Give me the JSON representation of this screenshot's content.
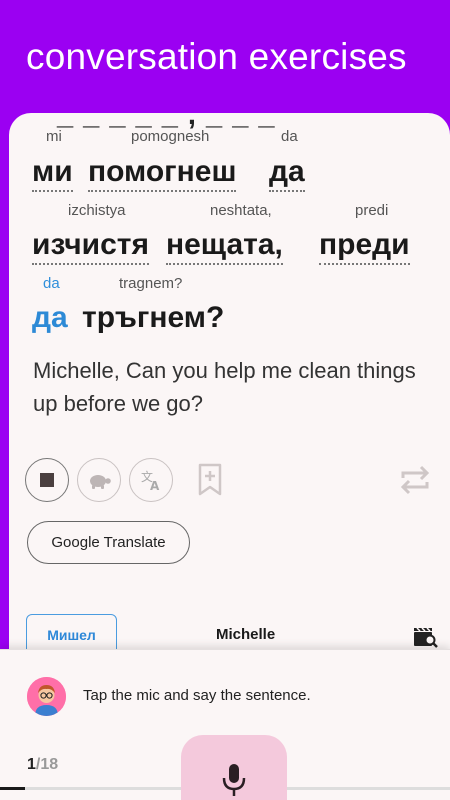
{
  "header": {
    "title": "conversation exercises"
  },
  "sentence": {
    "cut_line": "_ _ _ _ _ ,   _ _ _",
    "lines": [
      [
        {
          "translit": "mi",
          "word": "ми"
        },
        {
          "translit": "pomognesh",
          "word": "помогнеш"
        },
        {
          "translit": "da",
          "word": "да"
        }
      ],
      [
        {
          "translit": "izchistya",
          "word": "изчистя"
        },
        {
          "translit": "neshtata,",
          "word": "нещата,"
        },
        {
          "translit": "predi",
          "word": "преди"
        }
      ],
      [
        {
          "translit": "da",
          "word": "да"
        },
        {
          "translit": "tragnem?",
          "word": "тръгнем?"
        }
      ]
    ],
    "english": "Michelle, Can you help me clean things up before we go?"
  },
  "controls": {
    "icons": [
      "stop-icon",
      "turtle-icon",
      "translate-icon",
      "bookmark-add-icon",
      "repeat-icon"
    ],
    "google_translate_label": "Google Translate"
  },
  "speaker": {
    "name_bg": "Мишел",
    "name_en": "Michelle",
    "video_icon": "video-search-icon"
  },
  "bottom": {
    "instruction": "Tap the mic and say the sentence.",
    "progress_current": "1",
    "progress_total": "/18",
    "progress_fraction": 0.0556,
    "mic_icon": "mic-icon",
    "avatar_icon": "avatar-icon"
  },
  "colors": {
    "header_purple": "#9b00f2",
    "highlight_blue": "#2d8ad6",
    "mic_pink": "#f4c9dc",
    "avatar_pink": "#ff6fa8"
  }
}
